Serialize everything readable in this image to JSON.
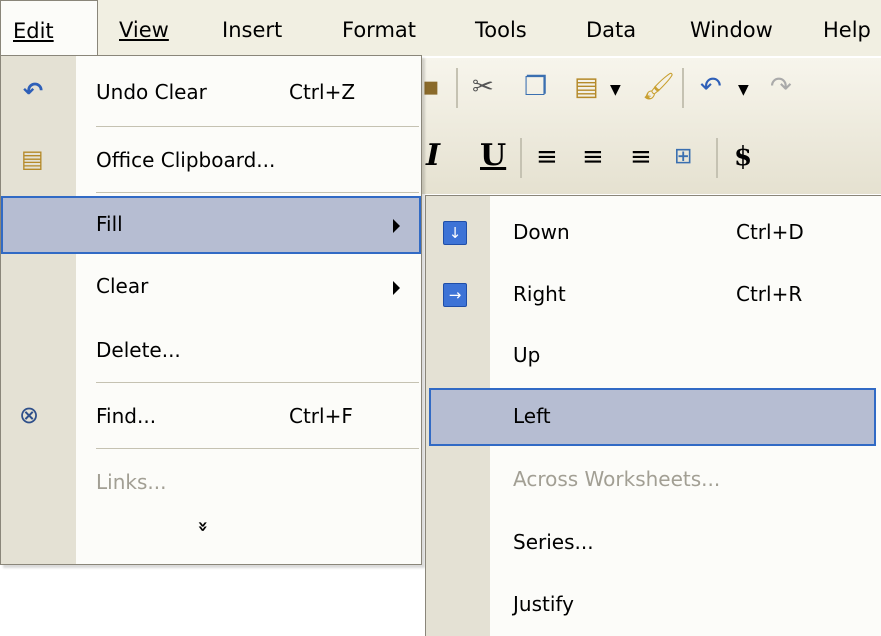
{
  "menubar": [
    {
      "label": "Edit"
    },
    {
      "label": "View"
    },
    {
      "label": "Insert"
    },
    {
      "label": "Format"
    },
    {
      "label": "Tools"
    },
    {
      "label": "Data"
    },
    {
      "label": "Window"
    },
    {
      "label": "Help"
    }
  ],
  "edit_menu": {
    "items": [
      {
        "label": "Undo Clear",
        "shortcut": "Ctrl+Z",
        "icon": "undo-icon"
      },
      {
        "label": "Office Clipboard...",
        "icon": "clipboard-icon"
      },
      {
        "label": "Fill",
        "submenu": true,
        "highlighted": true
      },
      {
        "label": "Clear",
        "submenu": true
      },
      {
        "label": "Delete..."
      },
      {
        "label": "Find...",
        "shortcut": "Ctrl+F",
        "icon": "binoculars-icon"
      },
      {
        "label": "Links...",
        "disabled": true
      }
    ],
    "expand_glyph": "»"
  },
  "fill_submenu": {
    "items": [
      {
        "label": "Down",
        "shortcut": "Ctrl+D",
        "icon": "fill-down-icon"
      },
      {
        "label": "Right",
        "shortcut": "Ctrl+R",
        "icon": "fill-right-icon"
      },
      {
        "label": "Up"
      },
      {
        "label": "Left",
        "highlighted": true
      },
      {
        "label": "Across Worksheets...",
        "disabled": true
      },
      {
        "label": "Series..."
      },
      {
        "label": "Justify"
      }
    ]
  },
  "toolbar": {
    "italic": "I",
    "underline": "U",
    "currency": "$"
  },
  "colors": {
    "highlight": "#b6bdd2",
    "highlight_border": "#316ac5",
    "gutter": "#e4e1d4",
    "disabled_text": "#a29f94"
  }
}
